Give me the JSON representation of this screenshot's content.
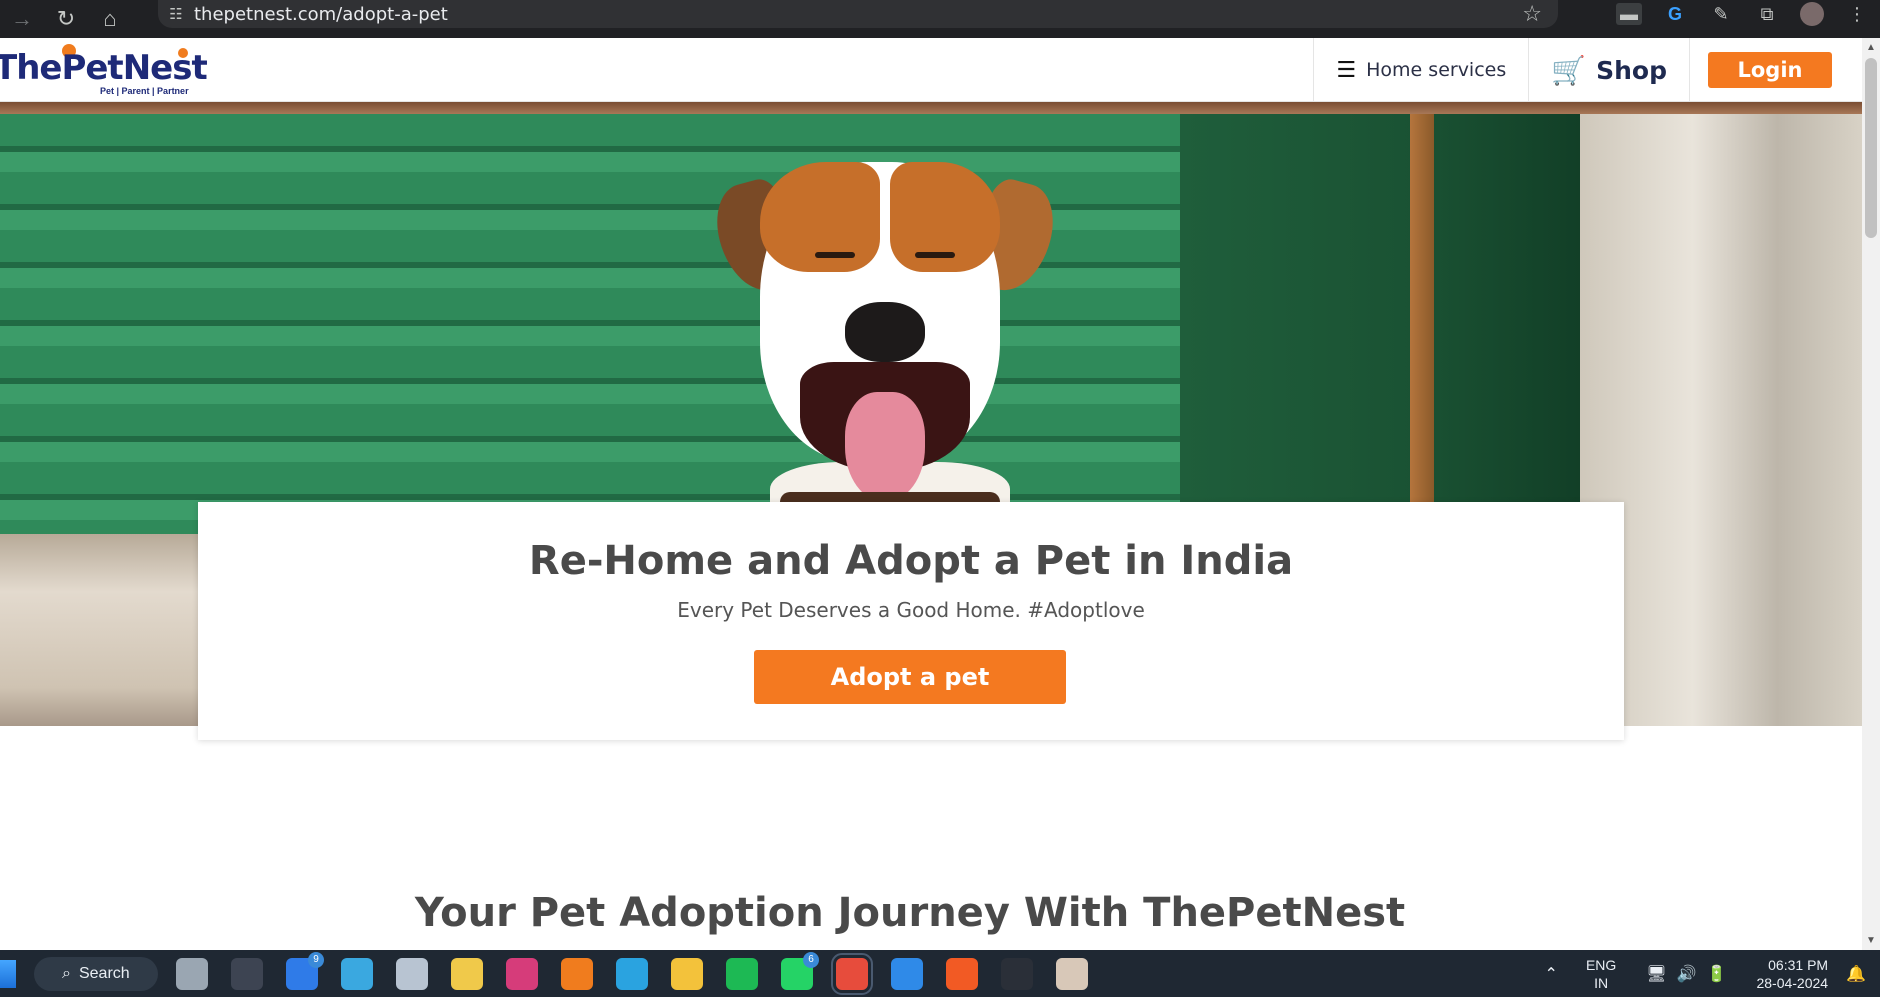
{
  "browser": {
    "url": "thepetnest.com/adopt-a-pet",
    "icons": [
      "forward-icon",
      "reload-icon",
      "home-icon",
      "site-info-icon",
      "bookmark-star-icon",
      "extensions-puzzle-icon",
      "menu-dots-icon"
    ]
  },
  "header": {
    "logo_text": "ThePetNest",
    "logo_tagline": "Pet | Parent | Partner",
    "home_services": "Home services",
    "shop": "Shop",
    "login": "Login"
  },
  "hero": {
    "title": "Re-Home and Adopt a Pet in India",
    "subtitle": "Every Pet Deserves a Good Home. #Adoptlove",
    "cta": "Adopt a pet"
  },
  "journey": {
    "title": "Your Pet Adoption Journey With ThePetNest"
  },
  "taskbar": {
    "search": "Search",
    "apps": [
      {
        "name": "task-view-icon",
        "color": "#9aa6b2",
        "badge": ""
      },
      {
        "name": "unity-icon",
        "color": "#3d4452",
        "badge": ""
      },
      {
        "name": "todo-icon",
        "color": "#2f7be8",
        "badge": "9"
      },
      {
        "name": "notepad-icon",
        "color": "#3aa8e0",
        "badge": ""
      },
      {
        "name": "snipping-tool-icon",
        "color": "#b8c4d2",
        "badge": ""
      },
      {
        "name": "microsoft-store-icon",
        "color": "#f0c94a",
        "badge": ""
      },
      {
        "name": "instagram-icon",
        "color": "#d63c7a",
        "badge": ""
      },
      {
        "name": "vlc-icon",
        "color": "#f07c1e",
        "badge": ""
      },
      {
        "name": "telegram-icon",
        "color": "#2aa3e0",
        "badge": ""
      },
      {
        "name": "file-explorer-icon",
        "color": "#f3c23b",
        "badge": ""
      },
      {
        "name": "spotify-icon",
        "color": "#1db954",
        "badge": ""
      },
      {
        "name": "whatsapp-icon",
        "color": "#25d366",
        "badge": "6"
      },
      {
        "name": "chrome-icon",
        "color": "#e74c3c",
        "badge": ""
      },
      {
        "name": "vscode-icon",
        "color": "#2f8ae8",
        "badge": ""
      },
      {
        "name": "brave-icon",
        "color": "#f25a24",
        "badge": ""
      },
      {
        "name": "terminal-icon",
        "color": "#2a2f38",
        "badge": ""
      },
      {
        "name": "image-app-icon",
        "color": "#d8c8b8",
        "badge": ""
      }
    ],
    "lang_line1": "ENG",
    "lang_line2": "IN",
    "time": "06:31 PM",
    "date": "28-04-2024"
  },
  "colors": {
    "accent": "#f47920",
    "brand_navy": "#1e2a78",
    "browser_dark": "#202124",
    "taskbar": "#1f2833"
  }
}
